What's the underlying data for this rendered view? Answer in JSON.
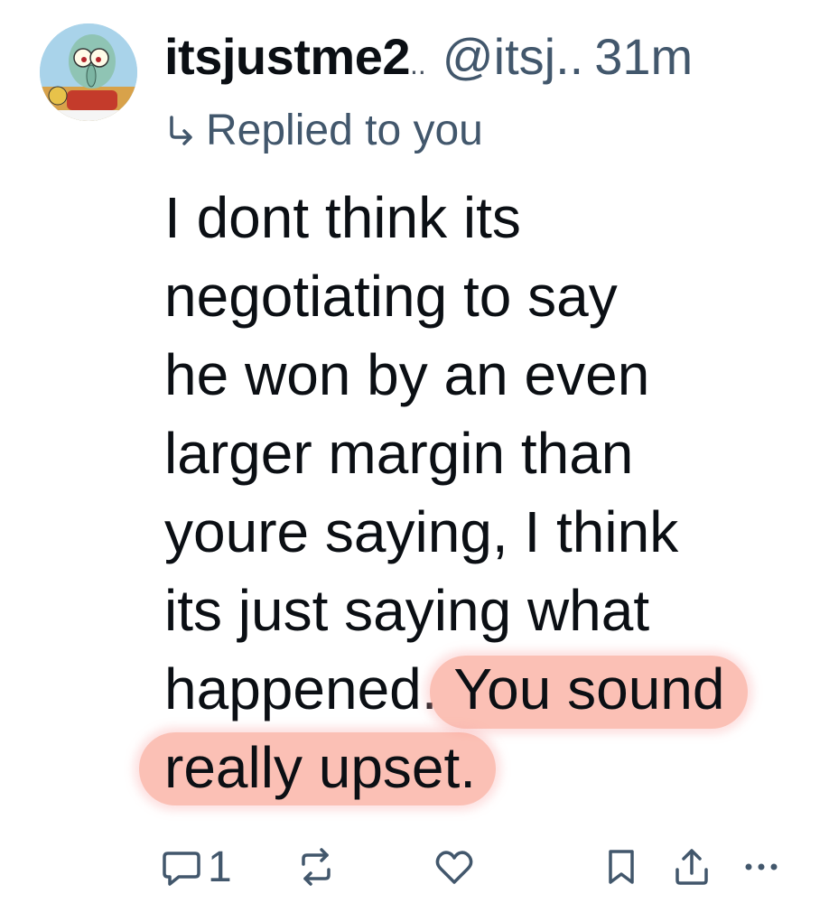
{
  "post": {
    "author": {
      "display_name": "itsjustme2",
      "name_ellipsis": "..",
      "handle": "@itsj..",
      "time": "31m",
      "avatar_icon": "squidward-avatar-icon"
    },
    "reply_label": "Replied to you",
    "body_lines": [
      "I dont think its",
      "negotiating to say",
      "he won by an even",
      "larger margin than",
      "youre saying, I think",
      "its just saying what"
    ],
    "body_line7_plain": "happened. ",
    "body_line7_highlight": "You sound",
    "body_line8_highlight": "really upset.",
    "highlight_color": "#f88c78",
    "actions": {
      "reply_count": "1",
      "reply_icon": "comment-icon",
      "repost_icon": "repost-icon",
      "like_icon": "heart-icon",
      "bookmark_icon": "bookmark-icon",
      "share_icon": "share-icon",
      "more_icon": "more-dots-icon"
    }
  }
}
